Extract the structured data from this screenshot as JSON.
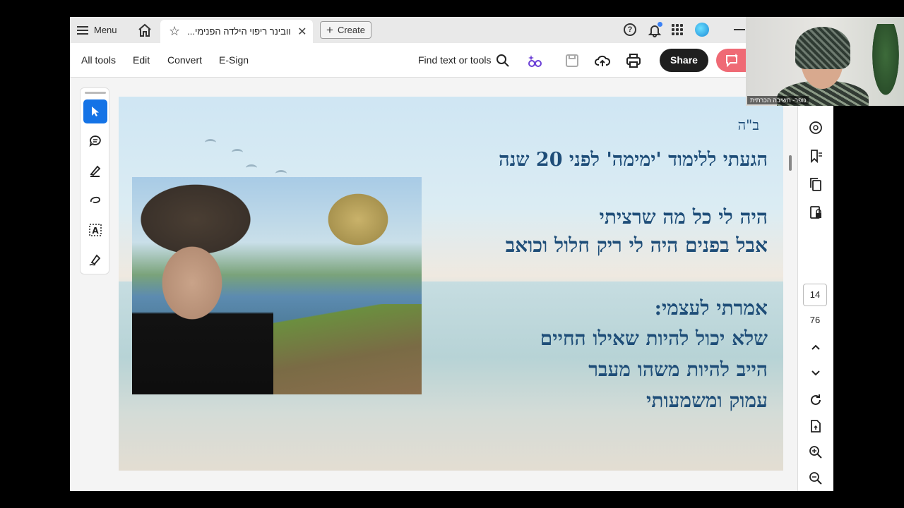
{
  "tabbar": {
    "menu_label": "Menu",
    "doc_tab_title": "וובינר ריפוי הילדה הפנימי...",
    "create_label": "Create"
  },
  "toolbar": {
    "all_tools": "All tools",
    "edit": "Edit",
    "convert": "Convert",
    "esign": "E-Sign",
    "find_text": "Find text or tools",
    "share": "Share"
  },
  "page": {
    "bh": "ב\"ה",
    "lines": [
      "הגעתי ללימוד 'ימימה' לפני 20 שנה",
      "היה לי כל מה שרציתי",
      "אבל בפנים היה לי ריק חלול וכואב",
      "אמרתי לעצמי:",
      "שלא יכול להיות שאילו החיים",
      "הייב להיות משהו מעבר",
      "עמוק ומשמעותי"
    ]
  },
  "navigation": {
    "current_page": "14",
    "total_pages": "76"
  },
  "webcam": {
    "participant_name": "נופר- חשיבה הכרתית"
  },
  "colors": {
    "accent": "#1473e6",
    "share_bg": "#1f1f1f",
    "ai_button": "#ef6a75",
    "hebrew_text": "#1e4d78"
  }
}
